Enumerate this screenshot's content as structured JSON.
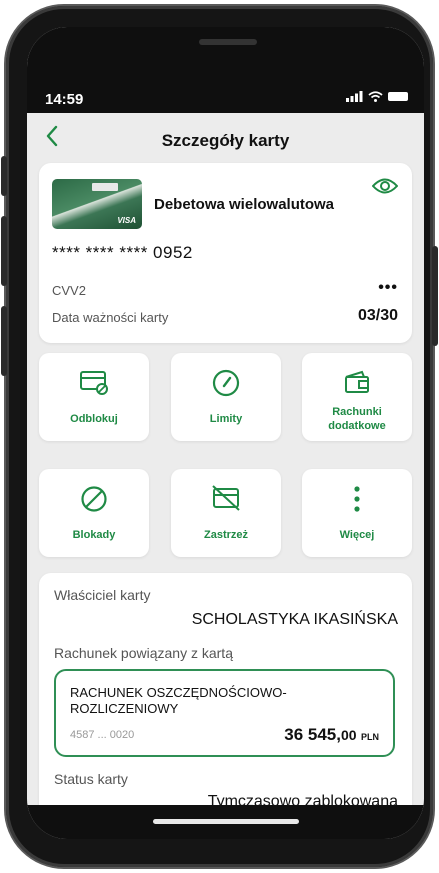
{
  "status": {
    "time": "14:59",
    "signal_icon": "signal-icon",
    "wifi_icon": "wifi-icon",
    "battery_icon": "battery-icon"
  },
  "header": {
    "title": "Szczegóły karty",
    "back_icon": "chevron-left-icon"
  },
  "card": {
    "name": "Debetowa wielowalutowa",
    "number": "**** **** **** 0952",
    "cvv_label": "CVV2",
    "cvv_value": "•••",
    "expiry_label": "Data ważności karty",
    "expiry_value": "03/30",
    "image_logo": "Grupa BPS",
    "image_brand": "VISA"
  },
  "actions": [
    {
      "label": "Odblokuj",
      "icon": "card-unlock-icon"
    },
    {
      "label": "Limity",
      "icon": "gauge-icon"
    },
    {
      "label": "Rachunki dodatkowe",
      "icon": "wallet-icon"
    },
    {
      "label": "Blokady",
      "icon": "block-icon"
    },
    {
      "label": "Zastrzeż",
      "icon": "card-cancel-icon"
    },
    {
      "label": "Więcej",
      "icon": "more-vertical-icon"
    }
  ],
  "details": {
    "owner_label": "Właściciel karty",
    "owner_value": "SCHOLASTYKA IKASIŃSKA",
    "linked_label": "Rachunek powiązany z kartą",
    "account_name": "RACHUNEK OSZCZĘDNOŚCIOWO-ROZLICZENIOWY",
    "account_number": "4587 ... 0020",
    "balance_main": "36 545,",
    "balance_decimal": "00",
    "balance_currency": "PLN",
    "status_label": "Status karty",
    "status_value": "Tymczasowo zablokowana"
  },
  "colors": {
    "accent": "#1f8a45",
    "background": "#ececec",
    "card": "#ffffff"
  }
}
